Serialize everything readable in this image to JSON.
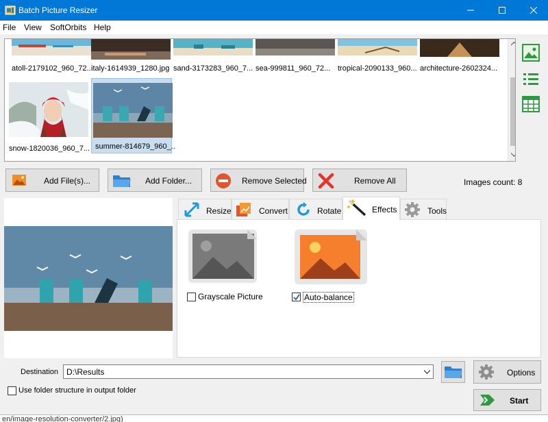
{
  "window": {
    "title": "Batch Picture Resizer",
    "accent_color": "#0078d7"
  },
  "menu": [
    "File",
    "View",
    "SoftOrbits",
    "Help"
  ],
  "gallery": {
    "items": [
      {
        "caption": "atoll-2179102_960_72...",
        "icon": "beach-photo"
      },
      {
        "caption": "italy-1614939_1280.jpg",
        "icon": "pebbles-photo"
      },
      {
        "caption": "sand-3173283_960_7...",
        "icon": "sea-photo"
      },
      {
        "caption": "sea-999811_960_72...",
        "icon": "pebbles-photo"
      },
      {
        "caption": "tropical-2090133_960...",
        "icon": "driftwood-photo"
      },
      {
        "caption": "architecture-2602324...",
        "icon": "street-photo"
      },
      {
        "caption": "snow-1820036_960_7...",
        "icon": "girl-in-snow-photo"
      },
      {
        "caption": "summer-814679_960_...",
        "icon": "beach-chairs-photo"
      }
    ],
    "selected_index": 7
  },
  "actions": {
    "add_files": "Add File(s)...",
    "add_folder": "Add Folder...",
    "remove_selected": "Remove Selected",
    "remove_all": "Remove All"
  },
  "images_count": "Images count: 8",
  "tabs": [
    {
      "label": "Resize",
      "icon": "resize-icon"
    },
    {
      "label": "Convert",
      "icon": "convert-icon"
    },
    {
      "label": "Rotate",
      "icon": "rotate-icon"
    },
    {
      "label": "Effects",
      "icon": "magic-wand-icon",
      "active": true
    },
    {
      "label": "Tools",
      "icon": "gear-icon"
    }
  ],
  "effects": {
    "grayscale": {
      "label": "Grayscale Picture",
      "checked": false
    },
    "autobalance": {
      "label": "Auto-balance",
      "checked": true
    }
  },
  "destination": {
    "label": "Destination",
    "value": "D:\\Results"
  },
  "options_label": "Options",
  "start_label": "Start",
  "folder_structure": {
    "label": "Use folder structure in output folder",
    "checked": false
  },
  "background_text": "en/image-resolution-converter/2.jpg)"
}
